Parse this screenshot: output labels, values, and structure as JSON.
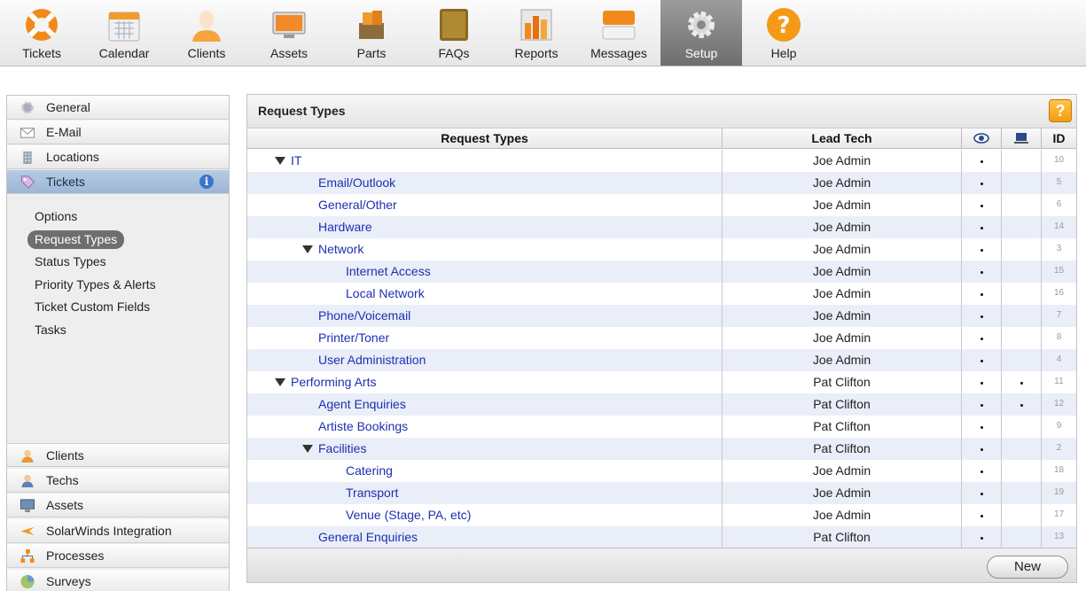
{
  "toolbar": {
    "items": [
      {
        "label": "Tickets",
        "icon": "lifebuoy-icon"
      },
      {
        "label": "Calendar",
        "icon": "calendar-icon"
      },
      {
        "label": "Clients",
        "icon": "person-icon"
      },
      {
        "label": "Assets",
        "icon": "monitor-icon"
      },
      {
        "label": "Parts",
        "icon": "parts-box-icon"
      },
      {
        "label": "FAQs",
        "icon": "book-icon"
      },
      {
        "label": "Reports",
        "icon": "reports-icon"
      },
      {
        "label": "Messages",
        "icon": "messages-icon"
      },
      {
        "label": "Setup",
        "icon": "gear-icon",
        "active": true
      },
      {
        "label": "Help",
        "icon": "help-icon"
      }
    ]
  },
  "sidebar": {
    "top_items": [
      {
        "label": "General",
        "icon": "gear-icon"
      },
      {
        "label": "E-Mail",
        "icon": "envelope-icon"
      },
      {
        "label": "Locations",
        "icon": "building-icon"
      },
      {
        "label": "Tickets",
        "icon": "tag-icon",
        "active": true
      }
    ],
    "sub_items": [
      {
        "label": "Options"
      },
      {
        "label": "Request Types",
        "active": true
      },
      {
        "label": "Status Types"
      },
      {
        "label": "Priority Types & Alerts"
      },
      {
        "label": "Ticket Custom Fields"
      },
      {
        "label": "Tasks"
      }
    ],
    "bottom_items": [
      {
        "label": "Clients",
        "icon": "clients-icon"
      },
      {
        "label": "Techs",
        "icon": "tech-icon"
      },
      {
        "label": "Assets",
        "icon": "monitor-icon"
      },
      {
        "label": "SolarWinds Integration",
        "icon": "solarwinds-icon"
      },
      {
        "label": "Processes",
        "icon": "processes-icon"
      },
      {
        "label": "Surveys",
        "icon": "surveys-icon"
      }
    ]
  },
  "panel": {
    "title": "Request Types",
    "help_label": "?",
    "columns": {
      "name": "Request Types",
      "lead": "Lead Tech",
      "visible_icon": "eye-icon",
      "tech_icon": "laptop-icon",
      "id": "ID"
    },
    "new_label": "New",
    "colors": {
      "link": "#1f2fb0",
      "alt_row": "#e9eef8",
      "active_nav": "#9db6d5"
    }
  },
  "rows": [
    {
      "name": "IT",
      "level": 0,
      "expanded": true,
      "lead": "Joe Admin",
      "visible": true,
      "tech_only": false,
      "id": "10"
    },
    {
      "name": "Email/Outlook",
      "level": 1,
      "lead": "Joe Admin",
      "visible": true,
      "tech_only": false,
      "id": "5"
    },
    {
      "name": "General/Other",
      "level": 1,
      "lead": "Joe Admin",
      "visible": true,
      "tech_only": false,
      "id": "6"
    },
    {
      "name": "Hardware",
      "level": 1,
      "lead": "Joe Admin",
      "visible": true,
      "tech_only": false,
      "id": "14"
    },
    {
      "name": "Network",
      "level": 1,
      "expanded": true,
      "lead": "Joe Admin",
      "visible": true,
      "tech_only": false,
      "id": "3"
    },
    {
      "name": "Internet Access",
      "level": 2,
      "lead": "Joe Admin",
      "visible": true,
      "tech_only": false,
      "id": "15"
    },
    {
      "name": "Local Network",
      "level": 2,
      "lead": "Joe Admin",
      "visible": true,
      "tech_only": false,
      "id": "16"
    },
    {
      "name": "Phone/Voicemail",
      "level": 1,
      "lead": "Joe Admin",
      "visible": true,
      "tech_only": false,
      "id": "7"
    },
    {
      "name": "Printer/Toner",
      "level": 1,
      "lead": "Joe Admin",
      "visible": true,
      "tech_only": false,
      "id": "8"
    },
    {
      "name": "User Administration",
      "level": 1,
      "lead": "Joe Admin",
      "visible": true,
      "tech_only": false,
      "id": "4"
    },
    {
      "name": "Performing Arts",
      "level": 0,
      "expanded": true,
      "lead": "Pat Clifton",
      "visible": true,
      "tech_only": true,
      "id": "11"
    },
    {
      "name": "Agent Enquiries",
      "level": 1,
      "lead": "Pat Clifton",
      "visible": true,
      "tech_only": true,
      "id": "12"
    },
    {
      "name": "Artiste Bookings",
      "level": 1,
      "lead": "Pat Clifton",
      "visible": true,
      "tech_only": false,
      "id": "9"
    },
    {
      "name": "Facilities",
      "level": 1,
      "expanded": true,
      "lead": "Pat Clifton",
      "visible": true,
      "tech_only": false,
      "id": "2"
    },
    {
      "name": "Catering",
      "level": 2,
      "lead": "Joe Admin",
      "visible": true,
      "tech_only": false,
      "id": "18"
    },
    {
      "name": "Transport",
      "level": 2,
      "lead": "Joe Admin",
      "visible": true,
      "tech_only": false,
      "id": "19"
    },
    {
      "name": "Venue (Stage, PA, etc)",
      "level": 2,
      "lead": "Joe Admin",
      "visible": true,
      "tech_only": false,
      "id": "17"
    },
    {
      "name": "General Enquiries",
      "level": 1,
      "lead": "Pat Clifton",
      "visible": true,
      "tech_only": false,
      "id": "13"
    }
  ]
}
